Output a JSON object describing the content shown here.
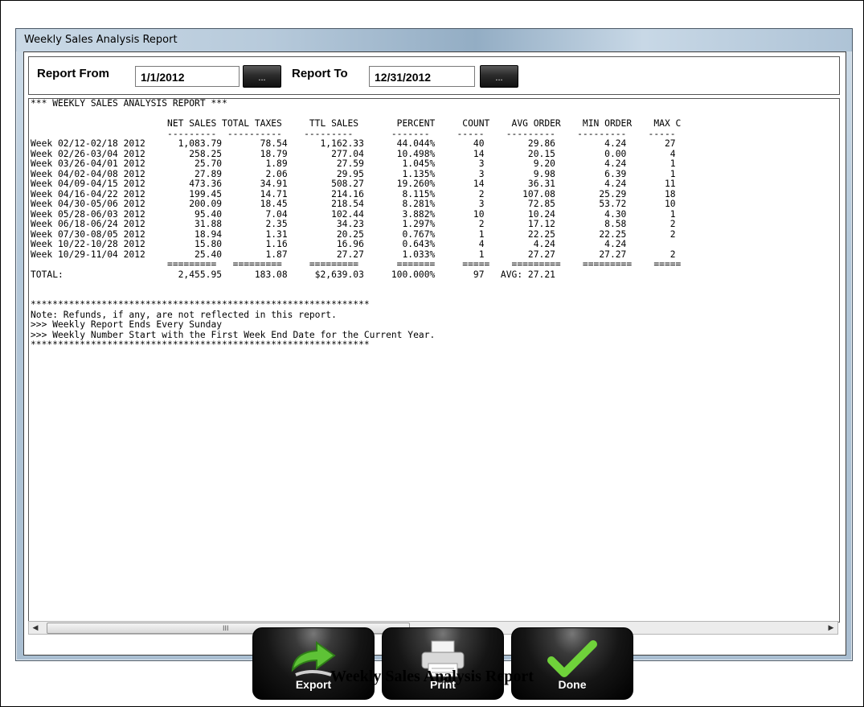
{
  "window": {
    "title": "Weekly Sales Analysis Report"
  },
  "filters": {
    "from_label": "Report From",
    "from_value": "1/1/2012",
    "to_label": "Report To",
    "to_value": "12/31/2012",
    "picker_label": "..."
  },
  "report": {
    "lines": [
      "*** WEEKLY SALES ANALYSIS REPORT ***",
      "",
      "                         NET SALES TOTAL TAXES     TTL SALES       PERCENT     COUNT    AVG ORDER    MIN ORDER    MAX C",
      "                         ---------  ----------    ---------       -------     -----    ---------    ---------    -----",
      "Week 02/12-02/18 2012      1,083.79       78.54      1,162.33      44.044%       40        29.86         4.24       27",
      "Week 02/26-03/04 2012        258.25       18.79        277.04      10.498%       14        20.15         0.00        4",
      "Week 03/26-04/01 2012         25.70        1.89         27.59       1.045%        3         9.20         4.24        1",
      "Week 04/02-04/08 2012         27.89        2.06         29.95       1.135%        3         9.98         6.39        1",
      "Week 04/09-04/15 2012        473.36       34.91        508.27      19.260%       14        36.31         4.24       11",
      "Week 04/16-04/22 2012        199.45       14.71        214.16       8.115%        2       107.08        25.29       18",
      "Week 04/30-05/06 2012        200.09       18.45        218.54       8.281%        3        72.85        53.72       10",
      "Week 05/28-06/03 2012         95.40        7.04        102.44       3.882%       10        10.24         4.30        1",
      "Week 06/18-06/24 2012         31.88        2.35         34.23       1.297%        2        17.12         8.58        2",
      "Week 07/30-08/05 2012         18.94        1.31         20.25       0.767%        1        22.25        22.25        2",
      "Week 10/22-10/28 2012         15.80        1.16         16.96       0.643%        4         4.24         4.24",
      "Week 10/29-11/04 2012         25.40        1.87         27.27       1.033%        1        27.27        27.27        2",
      "                         =========   =========     =========       =======     =====    =========    =========    =====",
      "TOTAL:                     2,455.95      183.08     $2,639.03     100.000%       97   AVG: 27.21",
      "",
      "",
      "**************************************************************",
      "Note: Refunds, if any, are not reflected in this report.",
      ">>> Weekly Report Ends Every Sunday",
      ">>> Weekly Number Start with the First Week End Date for the Current Year.",
      "**************************************************************"
    ]
  },
  "scrollbar": {
    "left_arrow": "◀",
    "right_arrow": "▶",
    "grip": "III"
  },
  "actions": {
    "export_label": "Export",
    "print_label": "Print",
    "done_label": "Done"
  },
  "caption": "Weekly Sales Analysis Report",
  "colors": {
    "button_dark": "#151515",
    "export_arrow": "#5ec236",
    "done_check": "#6fd23a"
  }
}
